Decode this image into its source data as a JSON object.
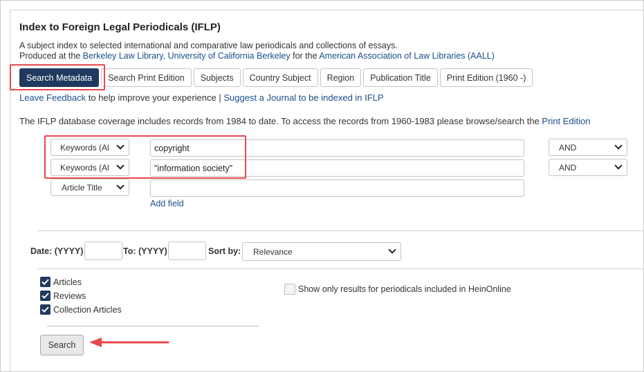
{
  "header": {
    "title": "Index to Foreign Legal Periodicals (IFLP)",
    "description_line1": "A subject index to selected international and comparative law periodicals and collections of essays.",
    "produced_prefix": "Produced at the ",
    "produced_link1": "Berkeley Law Library, University of California Berkeley",
    "produced_mid": " for the ",
    "produced_link2": "American Association of Law Libraries (AALL)"
  },
  "tabs": [
    {
      "label": "Search Metadata",
      "active": true
    },
    {
      "label": "Search Print Edition"
    },
    {
      "label": "Subjects"
    },
    {
      "label": "Country Subject"
    },
    {
      "label": "Region"
    },
    {
      "label": "Publication Title"
    },
    {
      "label": "Print Edition (1960 -)"
    }
  ],
  "feedback": {
    "link1": "Leave Feedback",
    "text1": " to help improve your experience | ",
    "link2": "Suggest a Journal to be indexed in IFLP"
  },
  "coverage": {
    "text": "The IFLP database coverage includes records from 1984 to date. To access the records from 1960-1983 please browse/search the ",
    "link": "Print Edition"
  },
  "search_rows": [
    {
      "field": "Keywords (Al",
      "value": "copyright",
      "operator": "AND"
    },
    {
      "field": "Keywords (Al",
      "value": "\"information society\"",
      "operator": "AND"
    },
    {
      "field": "Article Title",
      "value": ""
    }
  ],
  "add_field_label": "Add field",
  "date": {
    "from_label": "Date: (YYYY)",
    "to_label": "To: (YYYY)",
    "from_value": "",
    "to_value": ""
  },
  "sort": {
    "label": "Sort by:",
    "selected": "Relevance"
  },
  "types": [
    {
      "label": "Articles",
      "checked": true
    },
    {
      "label": "Reviews",
      "checked": true
    },
    {
      "label": "Collection Articles",
      "checked": true
    }
  ],
  "hein_option": {
    "label": "Show only results for periodicals included in HeinOnline",
    "checked": false
  },
  "search_button": "Search",
  "colors": {
    "active_tab": "#1e3a5f",
    "link": "#1a4f8b",
    "highlight": "#e8474c"
  }
}
